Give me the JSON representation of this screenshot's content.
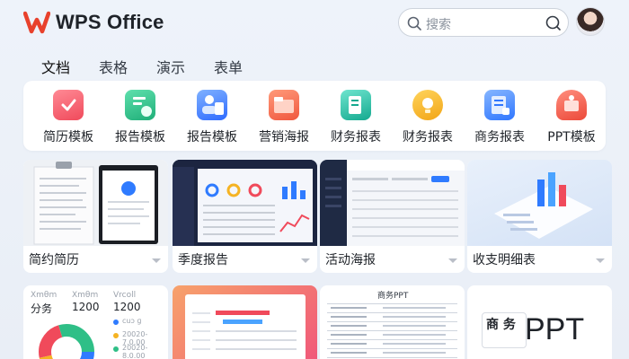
{
  "app": {
    "name": "WPS Office"
  },
  "search": {
    "placeholder": "搜索"
  },
  "tabs": [
    {
      "label": "文档",
      "active": true
    },
    {
      "label": "表格",
      "active": false
    },
    {
      "label": "演示",
      "active": false
    },
    {
      "label": "表单",
      "active": false
    }
  ],
  "categories": [
    {
      "label": "简历模板",
      "icon": "resume-icon",
      "color": "#f25a6b"
    },
    {
      "label": "报告模板",
      "icon": "report-icon",
      "color": "#2fbf87"
    },
    {
      "label": "报告模板",
      "icon": "report-user-icon",
      "color": "#3b82f6"
    },
    {
      "label": "营销海报",
      "icon": "poster-folder-icon",
      "color": "#f26b5b"
    },
    {
      "label": "财务报表",
      "icon": "finance-icon",
      "color": "#19b9a0"
    },
    {
      "label": "财务报表",
      "icon": "finance-bulb-icon",
      "color": "#f5b323"
    },
    {
      "label": "商务报表",
      "icon": "business-icon",
      "color": "#3a86ff"
    },
    {
      "label": "PPT模板",
      "icon": "ppt-icon",
      "color": "#f15a4a"
    }
  ],
  "templates": [
    {
      "title": "简约简历"
    },
    {
      "title": "季度报告"
    },
    {
      "title": "活动海报"
    },
    {
      "title": "收支明细表"
    }
  ],
  "bottom_cards": {
    "card1": {
      "headers": [
        "Χmθm",
        "Χmθm",
        "Vrcoll"
      ],
      "values": [
        "分务",
        "1200",
        "1200"
      ],
      "legend": [
        "cuɔ ɡ",
        "20020-7.0.00",
        "20020-8.0.00"
      ]
    },
    "card3": {
      "title": "商务PPT"
    },
    "card4": {
      "badge": "商 务",
      "text": "PPT"
    }
  },
  "colors": {
    "accent": "#2f6bff",
    "brand_red": "#e8412c"
  }
}
